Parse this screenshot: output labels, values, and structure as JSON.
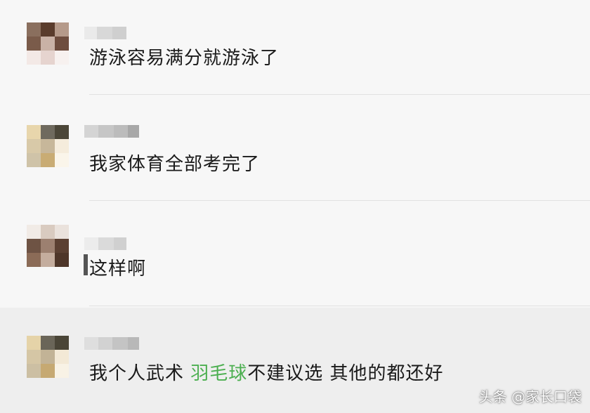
{
  "comments": [
    {
      "text": "游泳容易满分就游泳了"
    },
    {
      "text": "我家体育全部考完了"
    },
    {
      "text": "这样啊"
    },
    {
      "text_before": "我个人武术 ",
      "highlight": "羽毛球",
      "text_after": "不建议选  其他的都还好"
    }
  ],
  "colors": {
    "highlight": "#4caf50",
    "background": "#f7f7f7"
  },
  "watermark": "头条 @家长口袋"
}
